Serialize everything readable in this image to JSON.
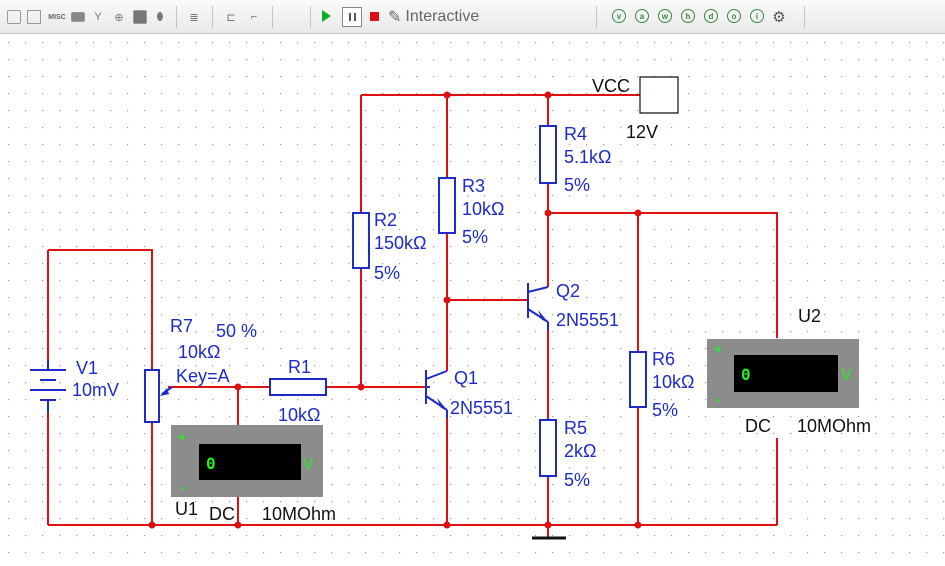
{
  "toolbar": {
    "misc_label": "MISC",
    "interactive_label": "Interactive",
    "instrument_icons": [
      "v",
      "a",
      "w",
      "h",
      "d",
      "o",
      "i"
    ]
  },
  "schematic": {
    "vcc": {
      "label": "VCC",
      "value": "12V"
    },
    "v1": {
      "name": "V1",
      "value": "10mV"
    },
    "r1": {
      "name": "R1",
      "value": "10kΩ"
    },
    "r2": {
      "name": "R2",
      "value": "150kΩ",
      "tolerance": "5%"
    },
    "r3": {
      "name": "R3",
      "value": "10kΩ",
      "tolerance": "5%"
    },
    "r4": {
      "name": "R4",
      "value": "5.1kΩ",
      "tolerance": "5%"
    },
    "r5": {
      "name": "R5",
      "value": "2kΩ",
      "tolerance": "5%"
    },
    "r6": {
      "name": "R6",
      "value": "10kΩ",
      "tolerance": "5%"
    },
    "r7": {
      "name": "R7",
      "percent": "50 %",
      "value": "10kΩ",
      "key": "Key=A"
    },
    "q1": {
      "name": "Q1",
      "model": "2N5551"
    },
    "q2": {
      "name": "Q2",
      "model": "2N5551"
    },
    "u1": {
      "name": "U1",
      "mode": "DC",
      "resistance": "10MOhm",
      "reading": "0",
      "unit": "V",
      "plus": "+",
      "minus": "-"
    },
    "u2": {
      "name": "U2",
      "mode": "DC",
      "resistance": "10MOhm",
      "reading": "0",
      "unit": "V",
      "plus": "+",
      "minus": "-"
    }
  },
  "colors": {
    "wire": "#dd1111",
    "component": "#1e2bc7",
    "label": "#1e2bc7",
    "meter_body": "#8c8c8c",
    "meter_display": "#000000",
    "meter_text": "#22ee22",
    "grid_dot": "#9a9a9a"
  }
}
